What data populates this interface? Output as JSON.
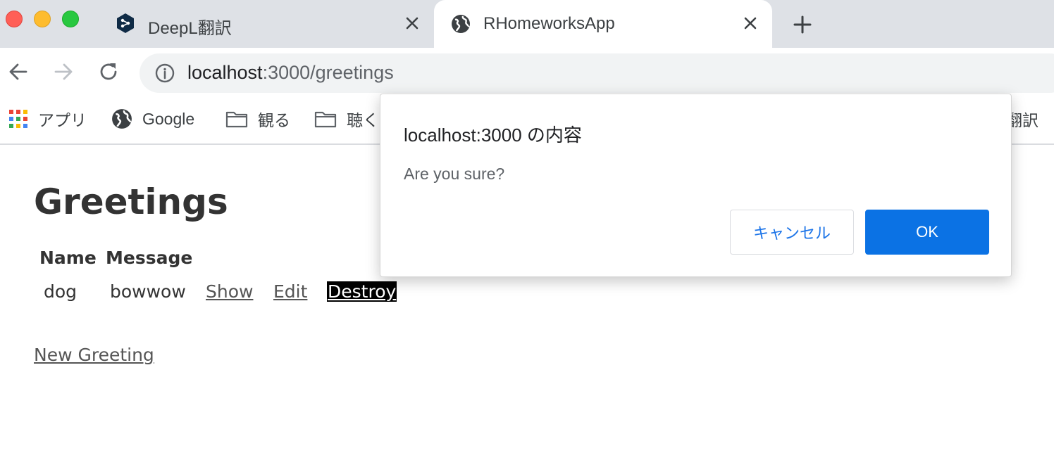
{
  "browser": {
    "tabs": [
      {
        "title": "DeepL翻訳",
        "icon": "deepl-logo-icon",
        "active": false
      },
      {
        "title": "RHomeworksApp",
        "icon": "globe-icon",
        "active": true
      }
    ],
    "new_tab_icon": "plus-icon",
    "address": {
      "host": "localhost",
      "rest": ":3000/greetings",
      "info_icon": "info-icon"
    },
    "nav_icons": [
      "back-arrow-icon",
      "forward-arrow-icon",
      "reload-icon"
    ],
    "bookmarks": [
      {
        "label": "アプリ",
        "icon": "apps-grid-icon"
      },
      {
        "label": "Google",
        "icon": "globe-icon"
      },
      {
        "label": "観る",
        "icon": "folder-icon"
      },
      {
        "label": "聴く",
        "icon": "folder-icon"
      },
      {
        "label": "翻訳",
        "icon": ""
      }
    ]
  },
  "page": {
    "title": "Greetings",
    "table": {
      "headers": [
        "Name",
        "Message"
      ],
      "rows": [
        {
          "name": "dog",
          "message": "bowwow",
          "show": "Show",
          "edit": "Edit",
          "destroy": "Destroy"
        }
      ]
    },
    "new_link": "New Greeting"
  },
  "dialog": {
    "title": "localhost:3000 の内容",
    "message": "Are you sure?",
    "cancel_label": "キャンセル",
    "ok_label": "OK",
    "accent_color": "#0b72e4"
  }
}
